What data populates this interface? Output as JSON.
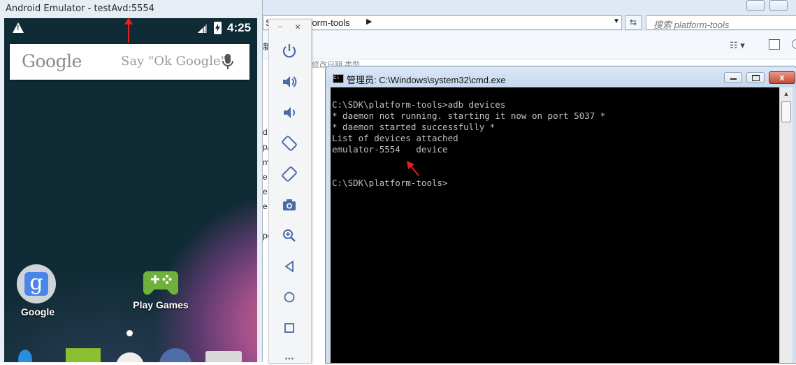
{
  "emulator": {
    "window_title": "Android Emulator - testAvd:5554",
    "status_bar": {
      "time": "4:25"
    },
    "search_widget": {
      "logo_text": "Google",
      "hint": "Say \"Ok Google\""
    },
    "apps": [
      {
        "label": "Google",
        "icon_letter": "g"
      },
      {
        "label": "Play Games"
      }
    ]
  },
  "emulator_toolbar": {
    "minimize": "−",
    "close": "×",
    "items": [
      "power-icon",
      "volume-up-icon",
      "volume-down-icon",
      "rotate-left-icon",
      "rotate-right-icon",
      "camera-icon",
      "zoom-icon",
      "back-icon",
      "home-icon",
      "overview-icon",
      "more-icon"
    ],
    "more_label": "..."
  },
  "explorer": {
    "address_path": "atform-tools",
    "address_prefix": "S",
    "search_placeholder": "搜索 platform-tools",
    "toolbar_fragment": "新",
    "sidebar_fragments": [
      "d",
      "pA",
      "m",
      "e",
      "e",
      "e",
      "pe"
    ],
    "column_fragment": "修改日期          类型"
  },
  "cmd": {
    "title": "管理员: C:\\Windows\\system32\\cmd.exe",
    "icon_text": "C:\\",
    "lines": [
      "C:\\SDK\\platform-tools>adb devices",
      "* daemon not running. starting it now on port 5037 *",
      "* daemon started successfully *",
      "List of devices attached",
      "emulator-5554   device",
      "",
      "",
      "C:\\SDK\\platform-tools>"
    ],
    "close_label": "x"
  },
  "colors": {
    "annotation_arrow": "#e8201c",
    "cmd_background": "#000000",
    "cmd_text": "#c0c0c0",
    "toolbar_icon": "#4a6aa8"
  }
}
